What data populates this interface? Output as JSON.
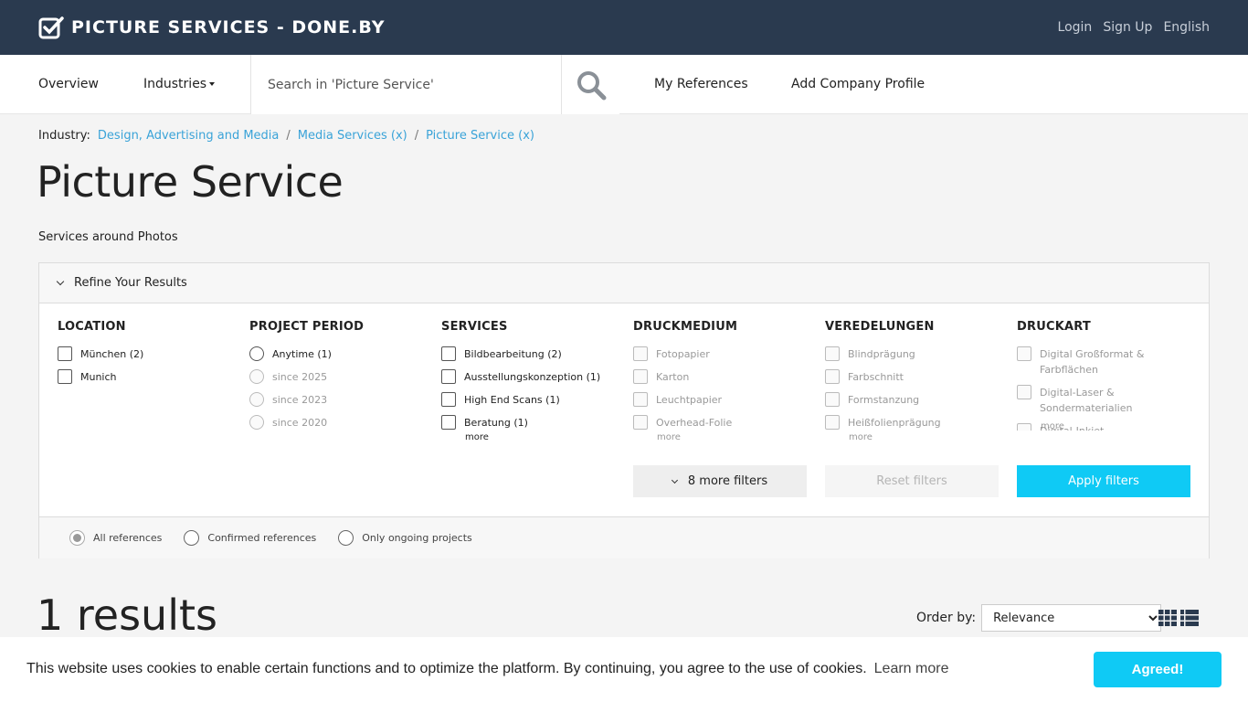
{
  "brand": {
    "name": "PICTURE SERVICES - DONE.BY"
  },
  "top_links": {
    "login": "Login",
    "signup": "Sign Up",
    "language": "English"
  },
  "nav": {
    "overview": "Overview",
    "industries": "Industries",
    "search_placeholder": "Search in 'Picture Service'",
    "my_references": "My References",
    "add_company": "Add Company Profile"
  },
  "breadcrumb": {
    "label": "Industry:",
    "items": [
      "Design, Advertising and Media",
      "Media Services (x)",
      "Picture Service (x)"
    ],
    "separator": "/"
  },
  "page": {
    "title": "Picture Service",
    "subtitle": "Services around Photos"
  },
  "refine": {
    "header": "Refine Your Results",
    "columns": [
      {
        "title": "LOCATION",
        "options": [
          "München (2)",
          "Munich"
        ]
      },
      {
        "title": "PROJECT PERIOD",
        "options": [
          "Anytime (1)",
          "since 2025",
          "since 2023",
          "since 2020"
        ]
      },
      {
        "title": "SERVICES",
        "options": [
          "Bildbearbeitung (2)",
          "Ausstellungskonzeption (1)",
          "High End Scans (1)",
          "Beratung (1)"
        ],
        "more": "more"
      },
      {
        "title": "DRUCKMEDIUM",
        "options": [
          "Fotopapier",
          "Karton",
          "Leuchtpapier",
          "Overhead-Folie"
        ],
        "more": "more"
      },
      {
        "title": "VEREDELUNGEN",
        "options": [
          "Blindprägung",
          "Farbschnitt",
          "Formstanzung",
          "Heißfolienprägung"
        ],
        "more": "more"
      },
      {
        "title": "DRUCKART",
        "options": [
          "Digital Großformat & Farbflächen",
          "Digital-Laser & Sondermaterialien",
          "Digital-Inkjet"
        ],
        "more": "more"
      }
    ],
    "more_filters": "8 more filters",
    "reset": "Reset filters",
    "apply": "Apply filters",
    "reference_options": [
      "All references",
      "Confirmed references",
      "Only ongoing projects"
    ],
    "reference_selected": "All references"
  },
  "results": {
    "count_text": "1 results",
    "order_label": "Order by:",
    "order_value": "Relevance"
  },
  "cookie": {
    "text": "This website uses cookies to enable certain functions and to optimize the platform. By continuing, you agree to the use of cookies.",
    "learn_more": "Learn more",
    "button": "Agreed!"
  },
  "colors": {
    "topbar": "#2a3a4f",
    "accent": "#0fcaf5",
    "link": "#3aa3d8"
  }
}
